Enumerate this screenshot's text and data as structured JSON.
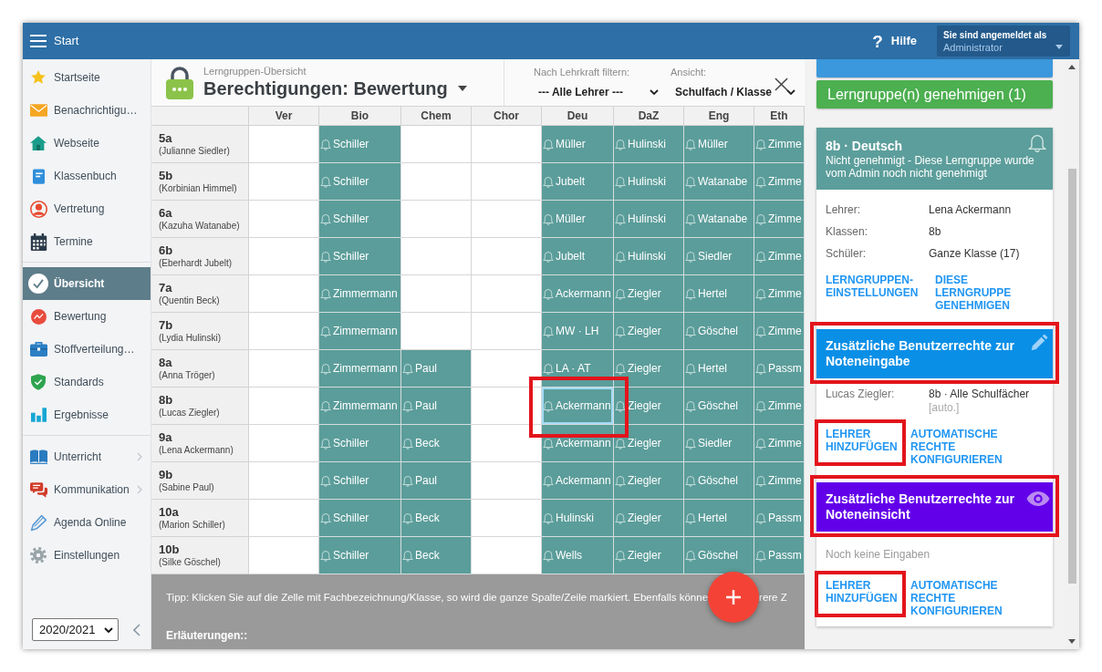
{
  "top_bar": {
    "menu_label": "Start",
    "help_icon": "?",
    "help_label": "Hilfe",
    "login": {
      "caption": "Sie sind angemeldet als",
      "user": "Administrator"
    }
  },
  "sidebar": {
    "groups": [
      [
        {
          "label": "Startseite",
          "kind": "star",
          "selected": false,
          "submenu": false
        },
        {
          "label": "Benachrichtigu…",
          "kind": "mail",
          "selected": false,
          "submenu": false
        },
        {
          "label": "Webseite",
          "kind": "house",
          "selected": false,
          "submenu": false
        },
        {
          "label": "Klassenbuch",
          "kind": "book",
          "selected": false,
          "submenu": false
        },
        {
          "label": "Vertretung",
          "kind": "person",
          "selected": false,
          "submenu": false
        },
        {
          "label": "Termine",
          "kind": "calendar",
          "selected": false,
          "submenu": false
        }
      ],
      [
        {
          "label": "Übersicht",
          "kind": "check",
          "selected": true,
          "submenu": false
        },
        {
          "label": "Bewertung",
          "kind": "trend",
          "selected": false,
          "submenu": false
        },
        {
          "label": "Stoffverteilung…",
          "kind": "briefcase",
          "selected": false,
          "submenu": false
        },
        {
          "label": "Standards",
          "kind": "shield",
          "selected": false,
          "submenu": false
        },
        {
          "label": "Ergebnisse",
          "kind": "bars",
          "selected": false,
          "submenu": false
        }
      ],
      [
        {
          "label": "Unterricht",
          "kind": "lesson",
          "selected": false,
          "submenu": true
        },
        {
          "label": "Kommunikation",
          "kind": "chat",
          "selected": false,
          "submenu": true
        },
        {
          "label": "Agenda Online",
          "kind": "pen",
          "selected": false,
          "submenu": false
        },
        {
          "label": "Einstellungen",
          "kind": "gear",
          "selected": false,
          "submenu": false
        }
      ]
    ],
    "year": "2020/2021"
  },
  "header": {
    "breadcrumb": "Lerngruppen-Übersicht",
    "title": "Berechtigungen: Bewertung",
    "filters": [
      {
        "label": "Nach Lehrkraft filtern:",
        "value": "--- Alle Lehrer ---"
      },
      {
        "label": "Ansicht:",
        "value": "Schulfach / Klasse"
      }
    ]
  },
  "table": {
    "columns": [
      "Ver",
      "Bio",
      "Chem",
      "Chor",
      "Deu",
      "DaZ",
      "Eng",
      "Eth"
    ],
    "rows": [
      {
        "class": "5a",
        "teacher": "(Julianne Siedler)",
        "cells": [
          {
            "filled": false,
            "selected": false,
            "highlighted": false
          },
          {
            "filled": true,
            "teacher": "Schiller",
            "selected": false,
            "highlighted": false
          },
          {
            "filled": false,
            "selected": false,
            "highlighted": false
          },
          {
            "filled": false,
            "selected": false,
            "highlighted": false
          },
          {
            "filled": true,
            "teacher": "Müller",
            "selected": false,
            "highlighted": false
          },
          {
            "filled": true,
            "teacher": "Hulinski",
            "selected": false,
            "highlighted": false
          },
          {
            "filled": true,
            "teacher": "Müller",
            "selected": false,
            "highlighted": false
          },
          {
            "filled": true,
            "teacher": "Zimme",
            "selected": false,
            "highlighted": false
          }
        ]
      },
      {
        "class": "5b",
        "teacher": "(Korbinian Himmel)",
        "cells": [
          {
            "filled": false,
            "selected": false,
            "highlighted": false
          },
          {
            "filled": true,
            "teacher": "Schiller",
            "selected": false,
            "highlighted": false
          },
          {
            "filled": false,
            "selected": false,
            "highlighted": false
          },
          {
            "filled": false,
            "selected": false,
            "highlighted": false
          },
          {
            "filled": true,
            "teacher": "Jubelt",
            "selected": false,
            "highlighted": false
          },
          {
            "filled": true,
            "teacher": "Hulinski",
            "selected": false,
            "highlighted": false
          },
          {
            "filled": true,
            "teacher": "Watanabe",
            "selected": false,
            "highlighted": false
          },
          {
            "filled": true,
            "teacher": "Zimme",
            "selected": false,
            "highlighted": false
          }
        ]
      },
      {
        "class": "6a",
        "teacher": "(Kazuha Watanabe)",
        "cells": [
          {
            "filled": false,
            "selected": false,
            "highlighted": false
          },
          {
            "filled": true,
            "teacher": "Schiller",
            "selected": false,
            "highlighted": false
          },
          {
            "filled": false,
            "selected": false,
            "highlighted": false
          },
          {
            "filled": false,
            "selected": false,
            "highlighted": false
          },
          {
            "filled": true,
            "teacher": "Müller",
            "selected": false,
            "highlighted": false
          },
          {
            "filled": true,
            "teacher": "Hulinski",
            "selected": false,
            "highlighted": false
          },
          {
            "filled": true,
            "teacher": "Watanabe",
            "selected": false,
            "highlighted": false
          },
          {
            "filled": true,
            "teacher": "Zimme",
            "selected": false,
            "highlighted": false
          }
        ]
      },
      {
        "class": "6b",
        "teacher": "(Eberhardt Jubelt)",
        "cells": [
          {
            "filled": false,
            "selected": false,
            "highlighted": false
          },
          {
            "filled": true,
            "teacher": "Schiller",
            "selected": false,
            "highlighted": false
          },
          {
            "filled": false,
            "selected": false,
            "highlighted": false
          },
          {
            "filled": false,
            "selected": false,
            "highlighted": false
          },
          {
            "filled": true,
            "teacher": "Jubelt",
            "selected": false,
            "highlighted": false
          },
          {
            "filled": true,
            "teacher": "Hulinski",
            "selected": false,
            "highlighted": false
          },
          {
            "filled": true,
            "teacher": "Siedler",
            "selected": false,
            "highlighted": false
          },
          {
            "filled": true,
            "teacher": "Zimme",
            "selected": false,
            "highlighted": false
          }
        ]
      },
      {
        "class": "7a",
        "teacher": "(Quentin Beck)",
        "cells": [
          {
            "filled": false,
            "selected": false,
            "highlighted": false
          },
          {
            "filled": true,
            "teacher": "Zimmermann",
            "selected": false,
            "highlighted": false
          },
          {
            "filled": false,
            "selected": false,
            "highlighted": false
          },
          {
            "filled": false,
            "selected": false,
            "highlighted": false
          },
          {
            "filled": true,
            "teacher": "Ackermann",
            "selected": false,
            "highlighted": false
          },
          {
            "filled": true,
            "teacher": "Ziegler",
            "selected": false,
            "highlighted": false
          },
          {
            "filled": true,
            "teacher": "Hertel",
            "selected": false,
            "highlighted": false
          },
          {
            "filled": true,
            "teacher": "Zimme",
            "selected": false,
            "highlighted": false
          }
        ]
      },
      {
        "class": "7b",
        "teacher": "(Lydia Hulinski)",
        "cells": [
          {
            "filled": false,
            "selected": false,
            "highlighted": false
          },
          {
            "filled": true,
            "teacher": "Zimmermann",
            "selected": false,
            "highlighted": false
          },
          {
            "filled": false,
            "selected": false,
            "highlighted": false
          },
          {
            "filled": false,
            "selected": false,
            "highlighted": false
          },
          {
            "filled": true,
            "teacher": "MW · LH",
            "selected": false,
            "highlighted": false
          },
          {
            "filled": true,
            "teacher": "Ziegler",
            "selected": false,
            "highlighted": false
          },
          {
            "filled": true,
            "teacher": "Göschel",
            "selected": false,
            "highlighted": false
          },
          {
            "filled": true,
            "teacher": "Zimme",
            "selected": false,
            "highlighted": false
          }
        ]
      },
      {
        "class": "8a",
        "teacher": "(Anna Tröger)",
        "cells": [
          {
            "filled": false,
            "selected": false,
            "highlighted": false
          },
          {
            "filled": true,
            "teacher": "Zimmermann",
            "selected": false,
            "highlighted": false
          },
          {
            "filled": true,
            "teacher": "Paul",
            "selected": false,
            "highlighted": false
          },
          {
            "filled": false,
            "selected": false,
            "highlighted": false
          },
          {
            "filled": true,
            "teacher": "LA · AT",
            "selected": false,
            "highlighted": false
          },
          {
            "filled": true,
            "teacher": "Ziegler",
            "selected": false,
            "highlighted": false
          },
          {
            "filled": true,
            "teacher": "Hertel",
            "selected": false,
            "highlighted": false
          },
          {
            "filled": true,
            "teacher": "Passm",
            "selected": false,
            "highlighted": false
          }
        ]
      },
      {
        "class": "8b",
        "teacher": "(Lucas Ziegler)",
        "cells": [
          {
            "filled": false,
            "selected": false,
            "highlighted": false
          },
          {
            "filled": true,
            "teacher": "Zimmermann",
            "selected": false,
            "highlighted": false
          },
          {
            "filled": true,
            "teacher": "Paul",
            "selected": false,
            "highlighted": false
          },
          {
            "filled": false,
            "selected": false,
            "highlighted": false
          },
          {
            "filled": true,
            "teacher": "Ackermann",
            "selected": true,
            "highlighted": true
          },
          {
            "filled": true,
            "teacher": "Ziegler",
            "selected": false,
            "highlighted": false
          },
          {
            "filled": true,
            "teacher": "Göschel",
            "selected": false,
            "highlighted": false
          },
          {
            "filled": true,
            "teacher": "Zimme",
            "selected": false,
            "highlighted": false
          }
        ]
      },
      {
        "class": "9a",
        "teacher": "(Lena Ackermann)",
        "cells": [
          {
            "filled": false,
            "selected": false,
            "highlighted": false
          },
          {
            "filled": true,
            "teacher": "Schiller",
            "selected": false,
            "highlighted": false
          },
          {
            "filled": true,
            "teacher": "Beck",
            "selected": false,
            "highlighted": false
          },
          {
            "filled": false,
            "selected": false,
            "highlighted": false
          },
          {
            "filled": true,
            "teacher": "Ackermann",
            "selected": false,
            "highlighted": false
          },
          {
            "filled": true,
            "teacher": "Ziegler",
            "selected": false,
            "highlighted": false
          },
          {
            "filled": true,
            "teacher": "Siedler",
            "selected": false,
            "highlighted": false
          },
          {
            "filled": true,
            "teacher": "Zimme",
            "selected": false,
            "highlighted": false
          }
        ]
      },
      {
        "class": "9b",
        "teacher": "(Sabine Paul)",
        "cells": [
          {
            "filled": false,
            "selected": false,
            "highlighted": false
          },
          {
            "filled": true,
            "teacher": "Schiller",
            "selected": false,
            "highlighted": false
          },
          {
            "filled": true,
            "teacher": "Paul",
            "selected": false,
            "highlighted": false
          },
          {
            "filled": false,
            "selected": false,
            "highlighted": false
          },
          {
            "filled": true,
            "teacher": "Ackermann",
            "selected": false,
            "highlighted": false
          },
          {
            "filled": true,
            "teacher": "Ziegler",
            "selected": false,
            "highlighted": false
          },
          {
            "filled": true,
            "teacher": "Göschel",
            "selected": false,
            "highlighted": false
          },
          {
            "filled": true,
            "teacher": "Zimme",
            "selected": false,
            "highlighted": false
          }
        ]
      },
      {
        "class": "10a",
        "teacher": "(Marion Schiller)",
        "cells": [
          {
            "filled": false,
            "selected": false,
            "highlighted": false
          },
          {
            "filled": true,
            "teacher": "Schiller",
            "selected": false,
            "highlighted": false
          },
          {
            "filled": true,
            "teacher": "Beck",
            "selected": false,
            "highlighted": false
          },
          {
            "filled": false,
            "selected": false,
            "highlighted": false
          },
          {
            "filled": true,
            "teacher": "Hulinski",
            "selected": false,
            "highlighted": false
          },
          {
            "filled": true,
            "teacher": "Ziegler",
            "selected": false,
            "highlighted": false
          },
          {
            "filled": true,
            "teacher": "Hertel",
            "selected": false,
            "highlighted": false
          },
          {
            "filled": true,
            "teacher": "Passm",
            "selected": false,
            "highlighted": false
          }
        ]
      },
      {
        "class": "10b",
        "teacher": "(Silke Göschel)",
        "cells": [
          {
            "filled": false,
            "selected": false,
            "highlighted": false
          },
          {
            "filled": true,
            "teacher": "Schiller",
            "selected": false,
            "highlighted": false
          },
          {
            "filled": true,
            "teacher": "Beck",
            "selected": false,
            "highlighted": false
          },
          {
            "filled": false,
            "selected": false,
            "highlighted": false
          },
          {
            "filled": true,
            "teacher": "Wells",
            "selected": false,
            "highlighted": false
          },
          {
            "filled": true,
            "teacher": "Ziegler",
            "selected": false,
            "highlighted": false
          },
          {
            "filled": true,
            "teacher": "Göschel",
            "selected": false,
            "highlighted": false
          },
          {
            "filled": true,
            "teacher": "Passm",
            "selected": false,
            "highlighted": false
          }
        ]
      }
    ]
  },
  "footer": {
    "tip_start": "Tipp: Klicken Sie auf die Zelle mit Fachbezeichnung/Klasse, so wird die ganze Spalte/Zeile markiert. Ebenfalls könne",
    "tip_end": "rere Z",
    "heading": "Erläuterungen::"
  },
  "side_panel": {
    "approve_button": "Lerngruppe(n) genehmigen (1)",
    "card": {
      "title": "8b · Deutsch",
      "subtitle": "Nicht genehmigt - Diese Lerngruppe wurde vom Admin noch nicht genehmigt",
      "details": [
        {
          "label": "Lehrer:",
          "value": "Lena Ackermann"
        },
        {
          "label": "Klassen:",
          "value": "8b"
        },
        {
          "label": "Schüler:",
          "value": "Ganze Klasse (17)"
        }
      ],
      "actions": [
        {
          "label": "LERNGRUPPEN-EINSTELLUNGEN",
          "highlighted": false
        },
        {
          "label": "DIESE LERNGRUPPE GENEHMIGEN",
          "highlighted": false
        }
      ],
      "sections": [
        {
          "kind": "edit",
          "title": "Zusätzliche Benutzerrechte zur Noteneingabe",
          "highlighted": true,
          "entries": [
            {
              "name": "Lucas Ziegler:",
              "scope": "8b · Alle Schulfächer",
              "note": "[auto.]"
            }
          ],
          "actions": [
            {
              "label": "LEHRER HINZUFÜGEN",
              "highlighted": true
            },
            {
              "label": "AUTOMATISCHE RECHTE KONFIGURIEREN",
              "highlighted": false
            }
          ]
        },
        {
          "kind": "view",
          "title": "Zusätzliche Benutzerrechte zur Noteneinsicht",
          "highlighted": true,
          "empty_text": "Noch keine Eingaben",
          "actions": [
            {
              "label": "LEHRER HINZUFÜGEN",
              "highlighted": true
            },
            {
              "label": "AUTOMATISCHE RECHTE KONFIGURIEREN",
              "highlighted": false
            }
          ]
        }
      ]
    }
  }
}
